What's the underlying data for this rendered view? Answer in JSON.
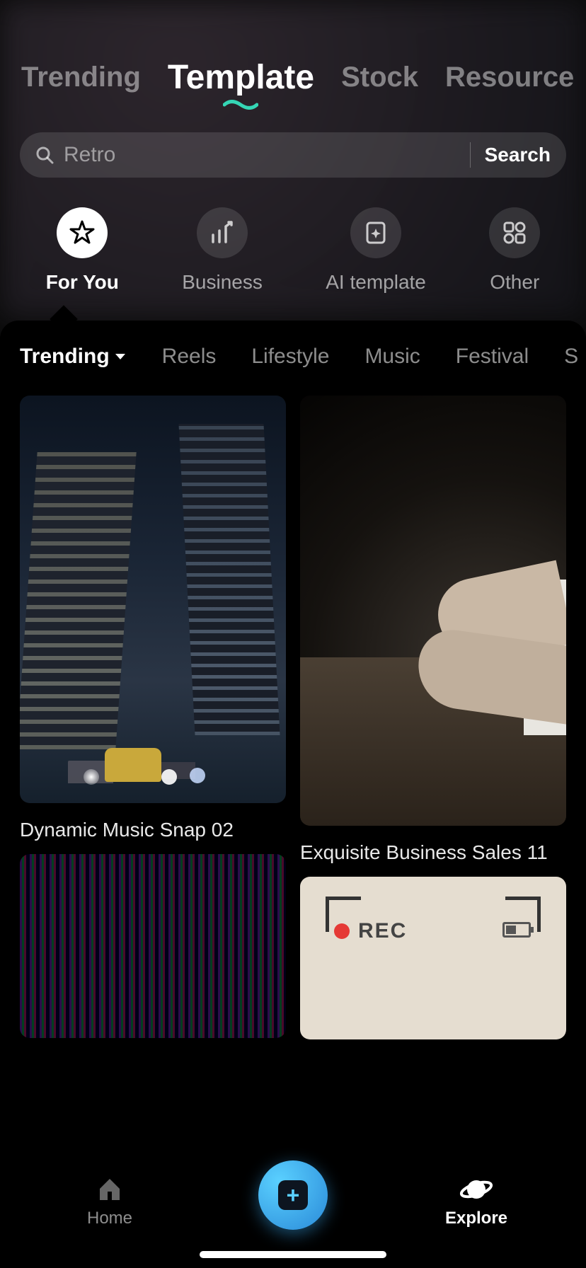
{
  "header": {
    "tabs": [
      "Trending",
      "Template",
      "Stock",
      "Resource"
    ],
    "active_tab_index": 1
  },
  "search": {
    "placeholder": "Retro",
    "button_label": "Search"
  },
  "categories": [
    {
      "label": "For You",
      "icon": "star-icon",
      "active": true
    },
    {
      "label": "Business",
      "icon": "chart-icon",
      "active": false
    },
    {
      "label": "AI template",
      "icon": "sparkle-card-icon",
      "active": false
    },
    {
      "label": "Other",
      "icon": "grid-icon",
      "active": false
    }
  ],
  "filters": {
    "items": [
      "Trending",
      "Reels",
      "Lifestyle",
      "Music",
      "Festival",
      "S"
    ],
    "active_index": 0,
    "has_dropdown_on_active": true
  },
  "templates": {
    "left_column": [
      {
        "title": "Dynamic Music Snap 02"
      },
      {
        "title": ""
      }
    ],
    "right_column": [
      {
        "title": "Exquisite Business Sales 11"
      },
      {
        "title": "",
        "rec_label": "REC"
      }
    ]
  },
  "bottom_nav": {
    "items": [
      {
        "label": "Home",
        "icon": "home-icon",
        "active": false
      },
      {
        "label": "Explore",
        "icon": "planet-icon",
        "active": true
      }
    ]
  }
}
